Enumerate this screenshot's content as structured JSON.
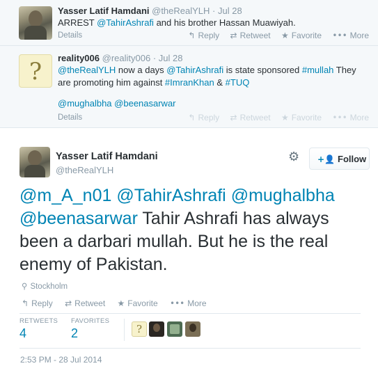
{
  "replies": [
    {
      "name": "Yasser Latif Hamdani",
      "handle": "@theRealYLH",
      "time": "· Jul 28",
      "text_prefix": "ARREST ",
      "mention": "@TahirAshrafi",
      "text_suffix": " and his brother Hassan Muawiyah.",
      "details": "Details"
    },
    {
      "name": "reality006",
      "handle": "@reality006",
      "time": "· Jul 28",
      "mention1": "@theRealYLH",
      "t1": " now a days ",
      "mention2": "@TahirAshrafi",
      "t2": " is state sponsored ",
      "hashtag1": "#mullah",
      "t3": "  They are promoting him against ",
      "hashtag2": "#ImranKhan",
      "t4": " & ",
      "hashtag3": "#TUQ",
      "mention3": "@mughalbha",
      "mention4": "@beenasarwar",
      "details": "Details"
    }
  ],
  "actions": {
    "reply": "Reply",
    "retweet": "Retweet",
    "favorite": "Favorite",
    "more": "More"
  },
  "icons": {
    "reply": "reply-arrow-icon",
    "retweet": "retweet-icon",
    "favorite": "star-icon",
    "more": "ellipsis-icon",
    "gear": "gear-icon",
    "follow": "add-user-icon",
    "location": "location-pin-icon"
  },
  "main_tweet": {
    "name": "Yasser Latif Hamdani",
    "handle": "@theRealYLH",
    "follow_label": "Follow",
    "mention1": "@m_A_n01",
    "mention2": "@TahirAshrafi",
    "mention3": "@mughalbha",
    "mention4": "@beenasarwar",
    "text": " Tahir Ashrafi has always been a darbari mullah. But he is the real enemy of Pakistan.",
    "location": "Stockholm",
    "retweets_label": "RETWEETS",
    "retweets": "4",
    "favorites_label": "FAVORITES",
    "favorites": "2",
    "timestamp": "2:53 PM - 28 Jul 2014"
  },
  "colors": {
    "link": "#0084b4",
    "muted": "#8899a6",
    "text": "#292f33",
    "reply_bg": "#f5f8fa"
  }
}
